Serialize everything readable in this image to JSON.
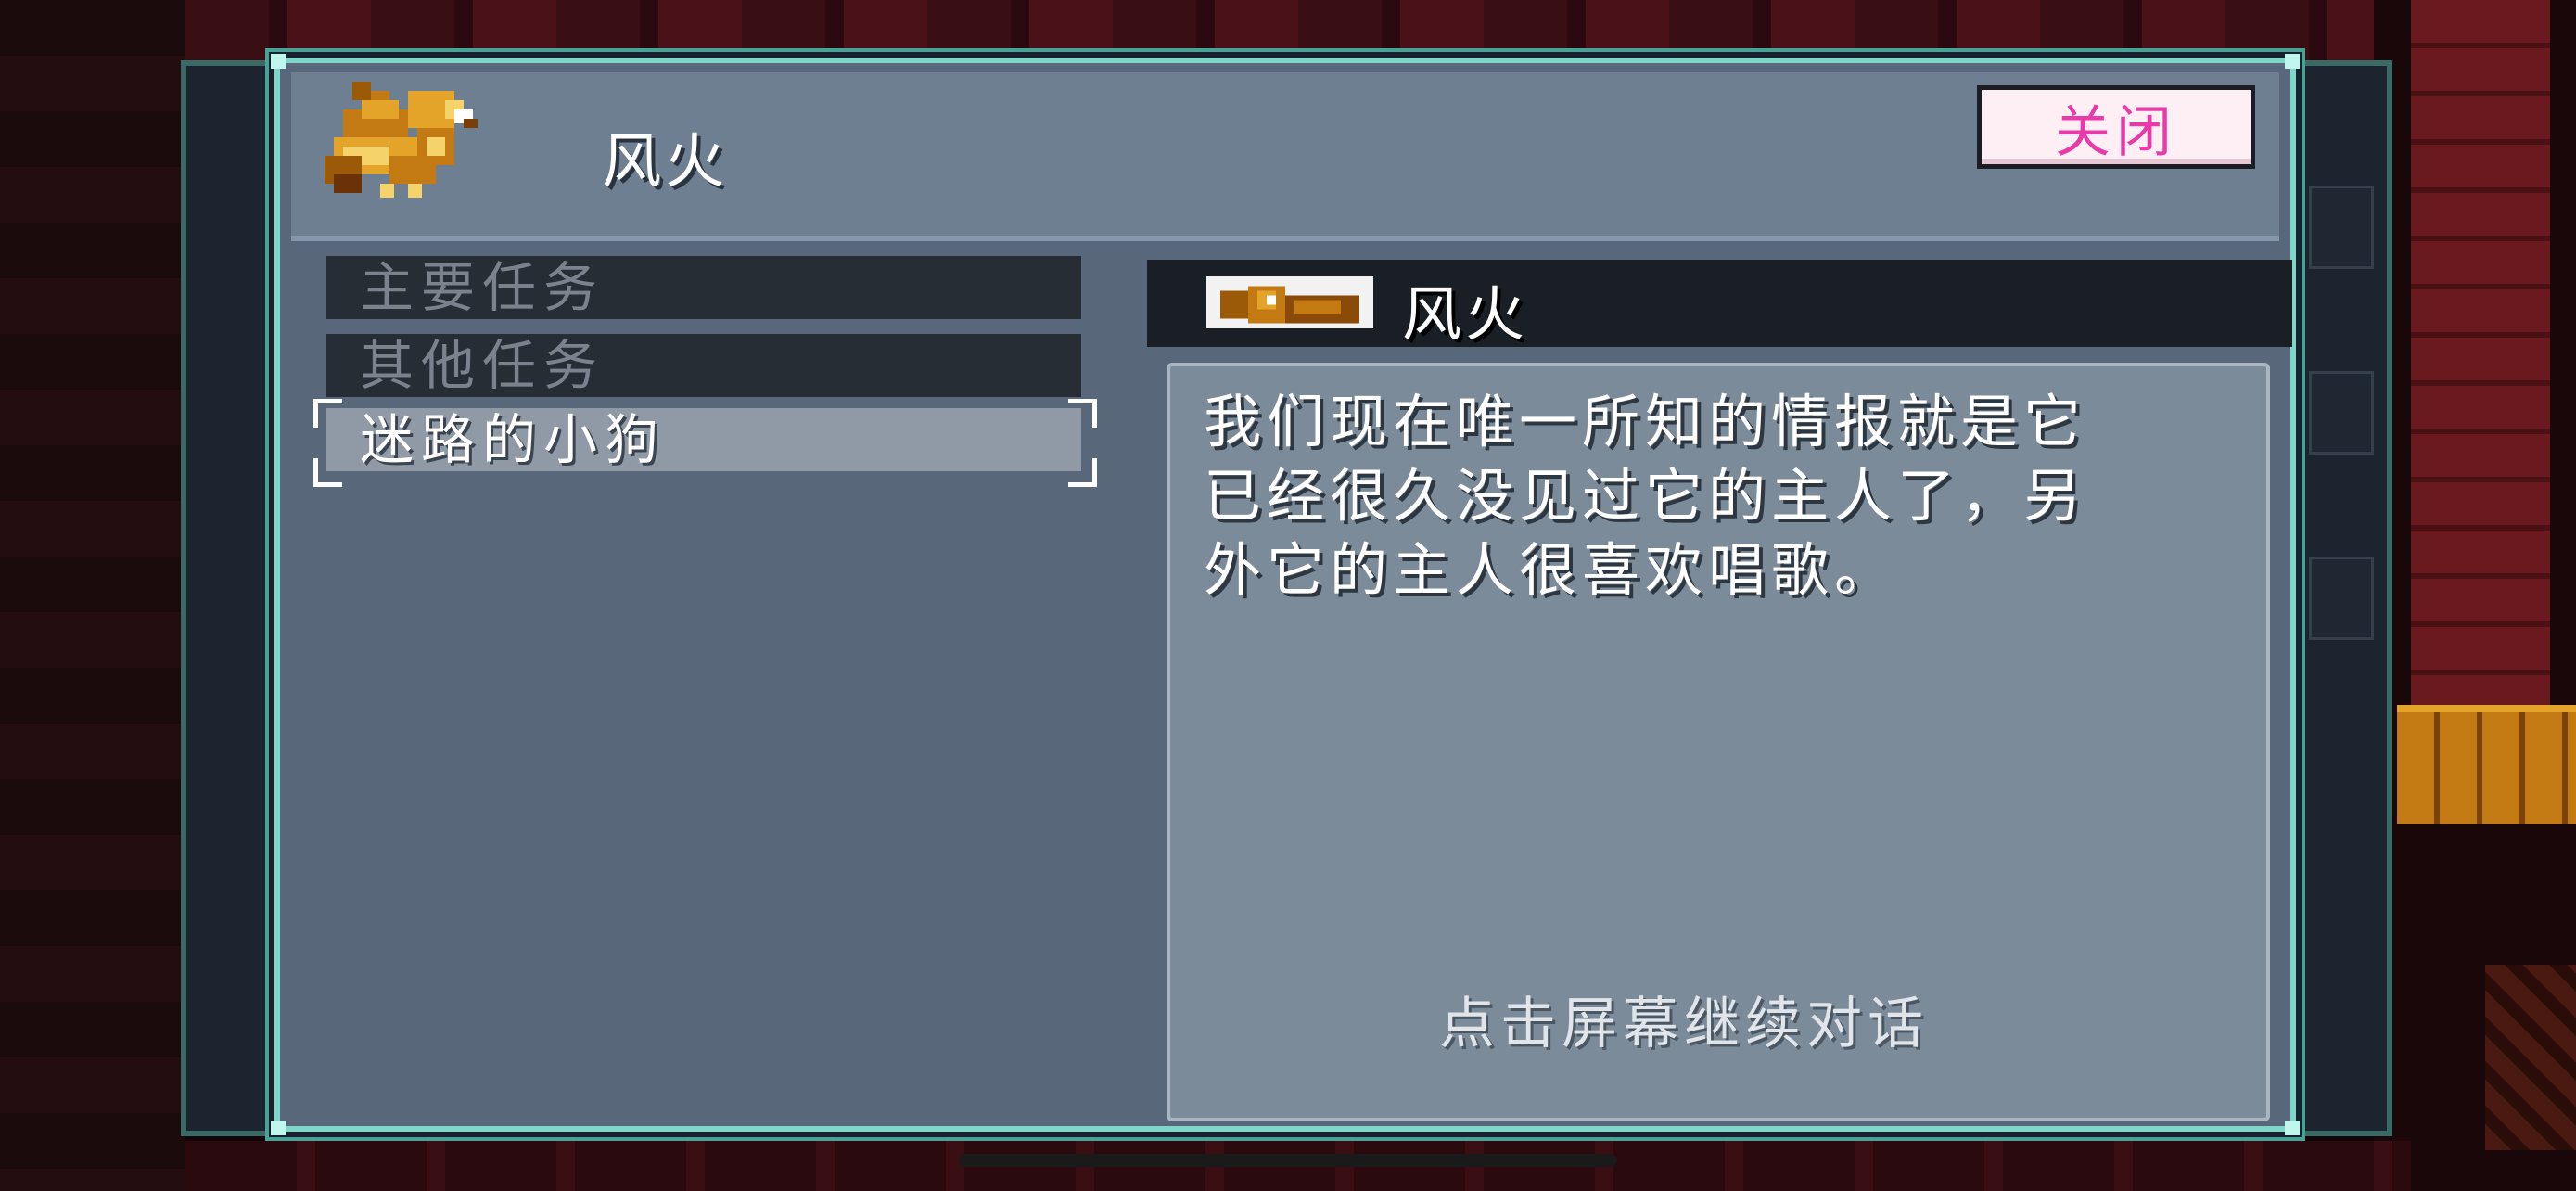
{
  "dialog": {
    "title": "风火",
    "close_label": "关闭",
    "accent_color": "#7fd6c8",
    "close_text_color": "#e83aa8"
  },
  "quest_list": {
    "categories": [
      "主要任务",
      "其他任务"
    ],
    "selected_quest": "迷路的小狗"
  },
  "speaker": {
    "name": "风火",
    "portrait_icon": "phoenix-portrait-icon"
  },
  "dialogue": {
    "lines": [
      "我们现在唯一所知的情报就是它",
      "已经很久没见过它的主人了，另",
      "外它的主人很喜欢唱歌。"
    ],
    "hint": "点击屏幕继续对话"
  },
  "icons": {
    "header_portrait": "phoenix-icon"
  }
}
